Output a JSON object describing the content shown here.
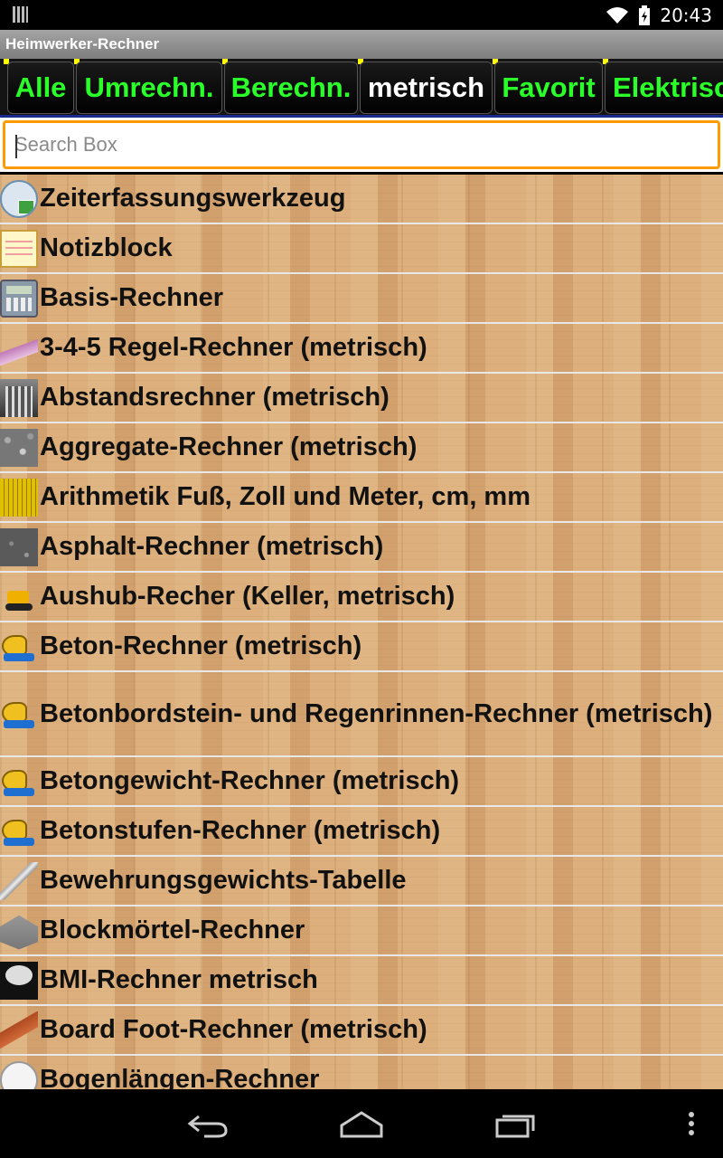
{
  "status_bar": {
    "time": "20:43",
    "icons": [
      "barcode-icon",
      "wifi-icon",
      "battery-icon"
    ]
  },
  "app": {
    "title": "Heimwerker-Rechner"
  },
  "tabs": [
    {
      "label": "Alle",
      "active": false
    },
    {
      "label": "Umrechn.",
      "active": false
    },
    {
      "label": "Berechn.",
      "active": false
    },
    {
      "label": "metrisch",
      "active": true
    },
    {
      "label": "Favorit",
      "active": false
    },
    {
      "label": "Elektrisch",
      "active": false
    }
  ],
  "search": {
    "placeholder": "Search Box",
    "value": ""
  },
  "list": {
    "items": [
      {
        "label": "Zeiterfassungswerkzeug",
        "icon": "clock-icon"
      },
      {
        "label": "Notizblock",
        "icon": "notepad-icon"
      },
      {
        "label": "Basis-Rechner",
        "icon": "calculator-icon"
      },
      {
        "label": "3-4-5 Regel-Rechner (metrisch)",
        "icon": "triangle-icon"
      },
      {
        "label": "Abstandsrechner (metrisch)",
        "icon": "railing-icon"
      },
      {
        "label": "Aggregate-Rechner (metrisch)",
        "icon": "gravel-icon"
      },
      {
        "label": "Arithmetik Fuß, Zoll und Meter, cm, mm",
        "icon": "tape-measure-icon"
      },
      {
        "label": "Asphalt-Rechner (metrisch)",
        "icon": "asphalt-icon"
      },
      {
        "label": "Aushub-Recher (Keller, metrisch)",
        "icon": "excavator-icon"
      },
      {
        "label": "Beton-Rechner (metrisch)",
        "icon": "cement-mixer-icon"
      },
      {
        "label": "Betonbordstein- und Regenrinnen-Rechner (metrisch)",
        "icon": "cement-mixer-icon"
      },
      {
        "label": "Betongewicht-Rechner (metrisch)",
        "icon": "cement-mixer-icon"
      },
      {
        "label": "Betonstufen-Rechner (metrisch)",
        "icon": "cement-mixer-icon"
      },
      {
        "label": "Bewehrungsgewichts-Tabelle",
        "icon": "rebar-icon"
      },
      {
        "label": "Blockmörtel-Rechner",
        "icon": "blocks-icon"
      },
      {
        "label": "BMI-Rechner metrisch",
        "icon": "scale-icon"
      },
      {
        "label": "Board Foot-Rechner (metrisch)",
        "icon": "board-icon"
      },
      {
        "label": "Bogenlängen-Rechner",
        "icon": "arc-icon"
      }
    ]
  },
  "nav_bar": {
    "buttons": [
      "back-icon",
      "home-icon",
      "recents-icon",
      "menu-icon"
    ]
  },
  "colors": {
    "tab_text": "#2aff2a",
    "tab_active_text": "#ffffff",
    "search_border": "#ff9a00",
    "list_background": "#d8a874"
  }
}
